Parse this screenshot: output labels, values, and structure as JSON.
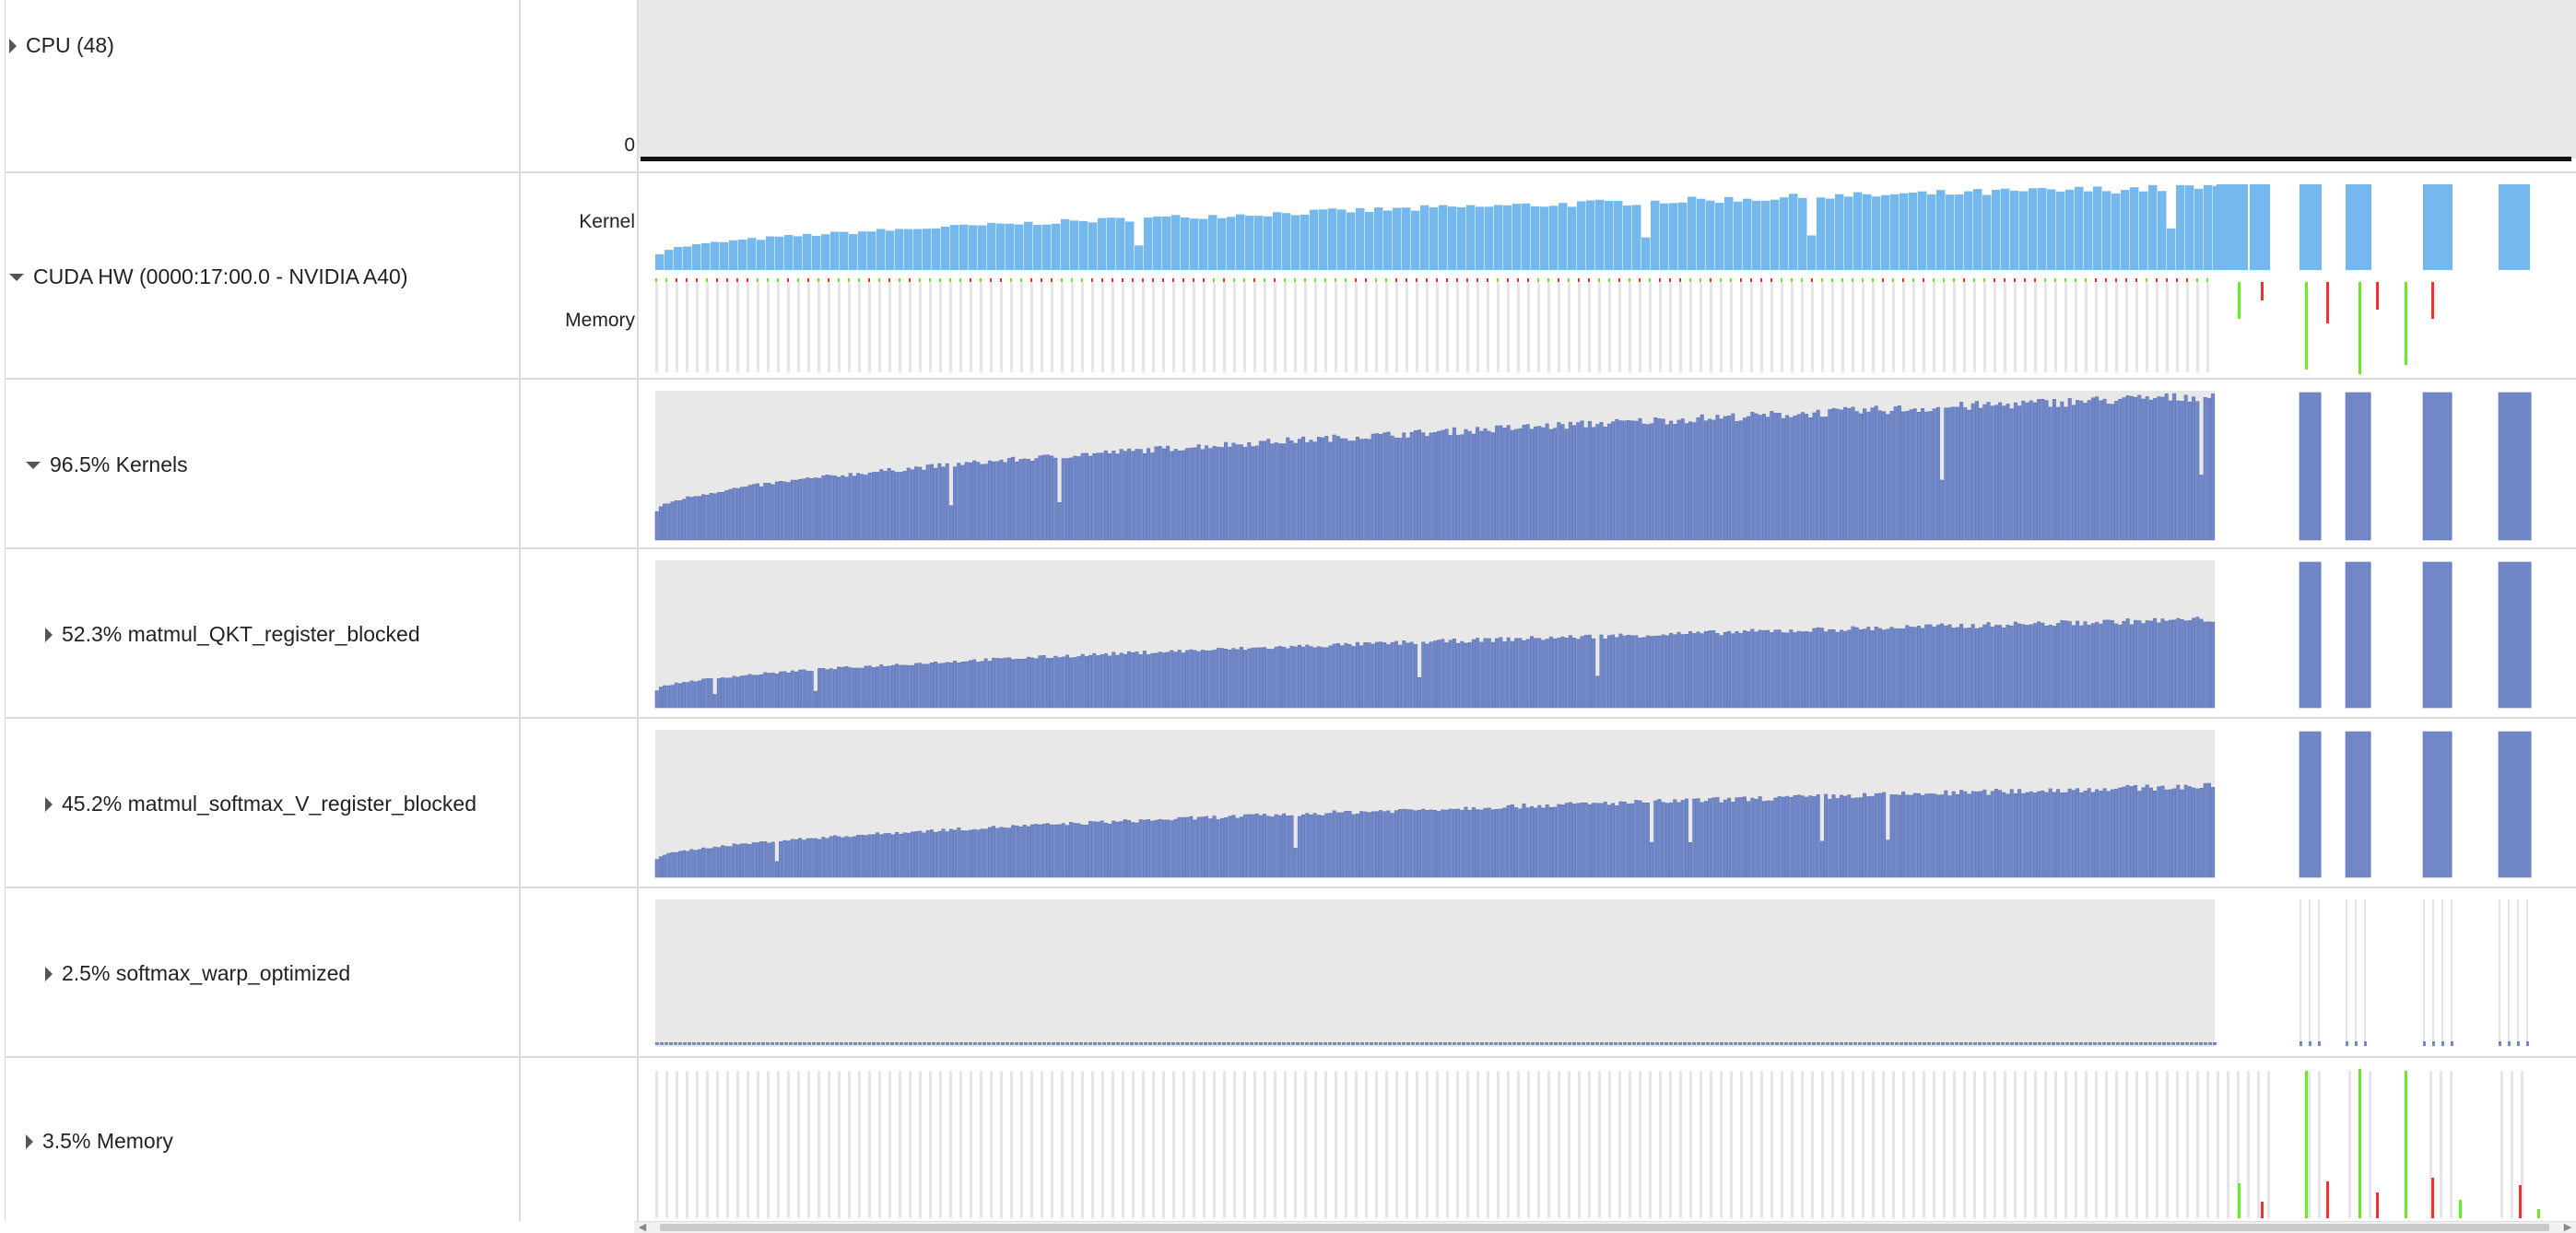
{
  "rows": {
    "cpu": {
      "label": "CPU (48)",
      "axis_zero": "0"
    },
    "cuda_hw": {
      "label": "CUDA HW (0000:17:00.0 - NVIDIA A40)",
      "kernel_label": "Kernel",
      "memory_label": "Memory"
    },
    "kernels": {
      "label": "96.5% Kernels"
    },
    "qkt": {
      "label": "52.3% matmul_QKT_register_blocked"
    },
    "softmax_v": {
      "label": "45.2% matmul_softmax_V_register_blocked"
    },
    "softmax_warp": {
      "label": "2.5% softmax_warp_optimized"
    },
    "memory": {
      "label": "3.5% Memory"
    }
  },
  "colors": {
    "track_bg": "#e8e8e8",
    "kernel_summary": "#74b8ee",
    "kernel_bars": "#7189cc",
    "kernel_bars_edge": "#5a6fae",
    "memory_green": "#66ee22",
    "memory_red": "#ee3333",
    "memory_gap": "#e6e6e6"
  },
  "icons": {
    "collapsed": "triangle-right-icon",
    "expanded": "triangle-down-icon",
    "scroll_left": "arrow-left-icon",
    "scroll_right": "arrow-right-icon"
  }
}
